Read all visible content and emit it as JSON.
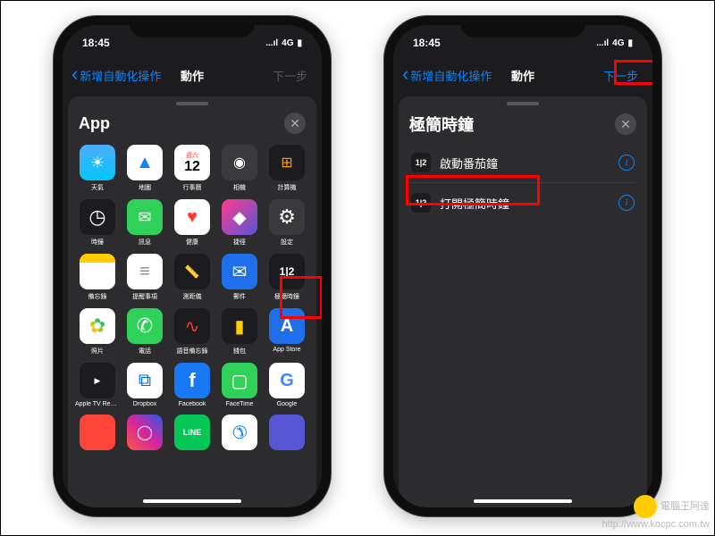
{
  "status": {
    "time": "18:45",
    "net": "4G",
    "sig": "...ıl",
    "bat": "▮"
  },
  "nav": {
    "back": "新增自動化操作",
    "center": "動作",
    "next": "下一步"
  },
  "left": {
    "title": "App",
    "apps": [
      [
        {
          "c": "weather",
          "l": "天氣"
        },
        {
          "c": "maps",
          "l": "地圖"
        },
        {
          "c": "cal",
          "l": "行事曆",
          "d": "週六",
          "n": "12"
        },
        {
          "c": "camera",
          "l": "相機"
        },
        {
          "c": "calc",
          "l": "計算機"
        }
      ],
      [
        {
          "c": "clock",
          "l": "時鐘"
        },
        {
          "c": "msg",
          "l": "訊息"
        },
        {
          "c": "health",
          "l": "健康"
        },
        {
          "c": "sc",
          "l": "捷徑"
        },
        {
          "c": "settings",
          "l": "設定"
        }
      ],
      [
        {
          "c": "notes",
          "l": "備忘錄"
        },
        {
          "c": "rem",
          "l": "提醒事項"
        },
        {
          "c": "measure",
          "l": "測距儀"
        },
        {
          "c": "mail",
          "l": "郵件"
        },
        {
          "c": "flip",
          "l": "極簡時鐘",
          "t": "1|2"
        }
      ],
      [
        {
          "c": "photos",
          "l": "照片"
        },
        {
          "c": "phoneic",
          "l": "電話"
        },
        {
          "c": "voice",
          "l": "語音備忘錄"
        },
        {
          "c": "wallet",
          "l": "錢包"
        },
        {
          "c": "astore",
          "l": "App Store"
        }
      ],
      [
        {
          "c": "atv",
          "l": "Apple TV Remote",
          "t": "▶"
        },
        {
          "c": "dbx",
          "l": "Dropbox"
        },
        {
          "c": "fb",
          "l": "Facebook"
        },
        {
          "c": "ft",
          "l": "FaceTime"
        },
        {
          "c": "goog",
          "l": "Google"
        }
      ],
      [
        {
          "c": "gen1",
          "l": ""
        },
        {
          "c": "ig",
          "l": ""
        },
        {
          "c": "line",
          "l": "",
          "t": "LINE"
        },
        {
          "c": "mess",
          "l": ""
        },
        {
          "c": "gen2",
          "l": ""
        }
      ]
    ]
  },
  "right": {
    "title": "極簡時鐘",
    "items": [
      {
        "label": "啟動番茄鐘"
      },
      {
        "label": "打開極簡時鐘"
      }
    ]
  },
  "watermark": {
    "brand": "電腦王阿達",
    "url": "http://www.kocpc.com.tw"
  }
}
